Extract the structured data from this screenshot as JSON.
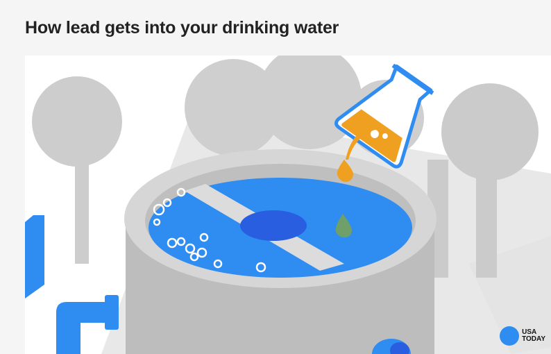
{
  "header": {
    "title": "How lead gets into your drinking water"
  },
  "logo": {
    "line1": "USA",
    "line2": "TODAY"
  },
  "colors": {
    "water": "#2f8cf0",
    "dark_water": "#2a5ee0",
    "lead": "#f0a020",
    "tank": "#c9c9c9",
    "trees": "#cfcfcf"
  }
}
